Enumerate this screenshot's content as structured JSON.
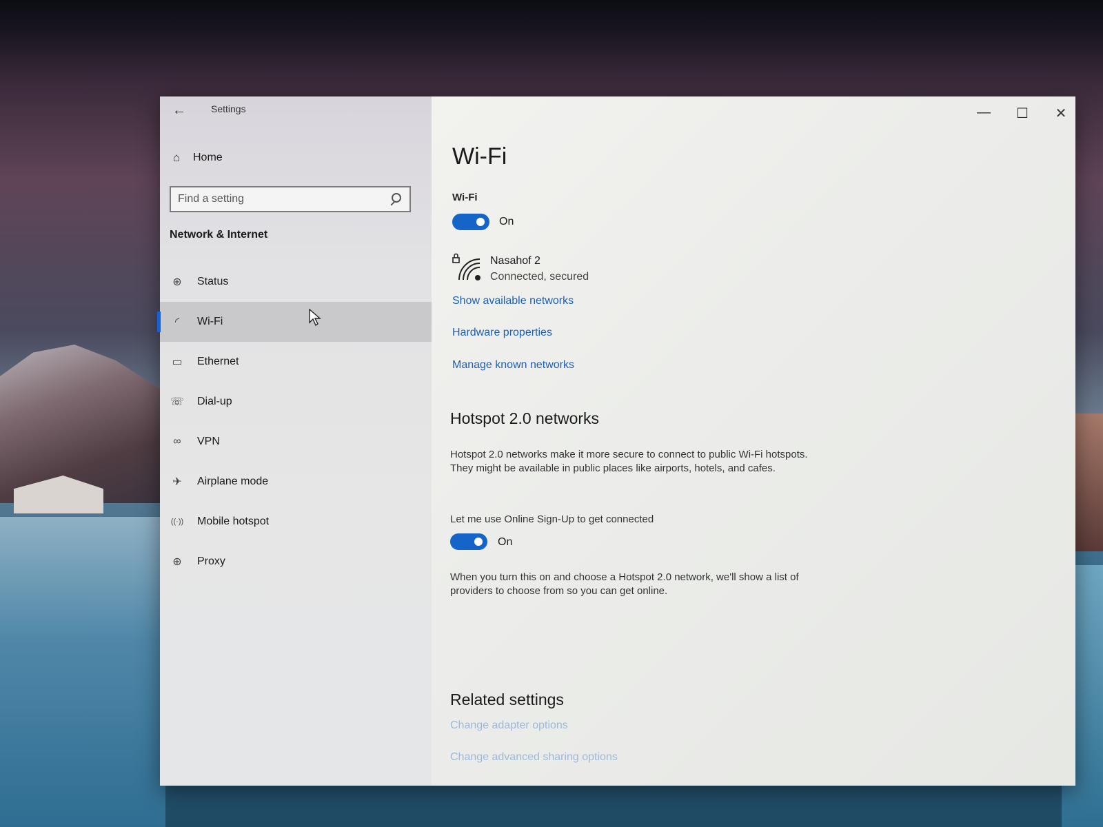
{
  "window": {
    "title": "Settings",
    "controls": {
      "minimize": "—",
      "maximize": "☐",
      "close": "✕"
    }
  },
  "sidebar": {
    "home_label": "Home",
    "search_placeholder": "Find a setting",
    "section_title": "Network & Internet",
    "items": [
      {
        "label": "Status",
        "icon": "globe-status-icon",
        "glyph": "⊕",
        "selected": false
      },
      {
        "label": "Wi-Fi",
        "icon": "wifi-icon",
        "glyph": "◜",
        "selected": true
      },
      {
        "label": "Ethernet",
        "icon": "ethernet-icon",
        "glyph": "▭",
        "selected": false
      },
      {
        "label": "Dial-up",
        "icon": "dialup-icon",
        "glyph": "☏",
        "selected": false
      },
      {
        "label": "VPN",
        "icon": "vpn-icon",
        "glyph": "∞",
        "selected": false
      },
      {
        "label": "Airplane mode",
        "icon": "airplane-icon",
        "glyph": "✈",
        "selected": false
      },
      {
        "label": "Mobile hotspot",
        "icon": "mobile-hotspot-icon",
        "glyph": "((·))",
        "selected": false
      },
      {
        "label": "Proxy",
        "icon": "globe-proxy-icon",
        "glyph": "⊕",
        "selected": false
      }
    ]
  },
  "main": {
    "page_title": "Wi-Fi",
    "wifi_label": "Wi-Fi",
    "wifi_toggle_state": "On",
    "network": {
      "name": "Nasahof 2",
      "status": "Connected, secured"
    },
    "links": [
      "Show available networks",
      "Hardware properties",
      "Manage known networks"
    ],
    "hotspot": {
      "title": "Hotspot 2.0 networks",
      "description": "Hotspot 2.0 networks make it more secure to connect to public Wi-Fi hotspots. They might be available in public places like airports, hotels, and cafes.",
      "toggle_label": "Let me use Online Sign-Up to get connected",
      "toggle_state": "On",
      "note": "When you turn this on and choose a Hotspot 2.0 network, we'll show a list of providers to choose from so you can get online."
    },
    "related": {
      "title": "Related settings",
      "links": [
        "Change adapter options",
        "Change advanced sharing options"
      ]
    }
  },
  "colors": {
    "accent": "#1565c8",
    "link": "#1c5fb8",
    "selection_bar": "#1a5fd0"
  }
}
